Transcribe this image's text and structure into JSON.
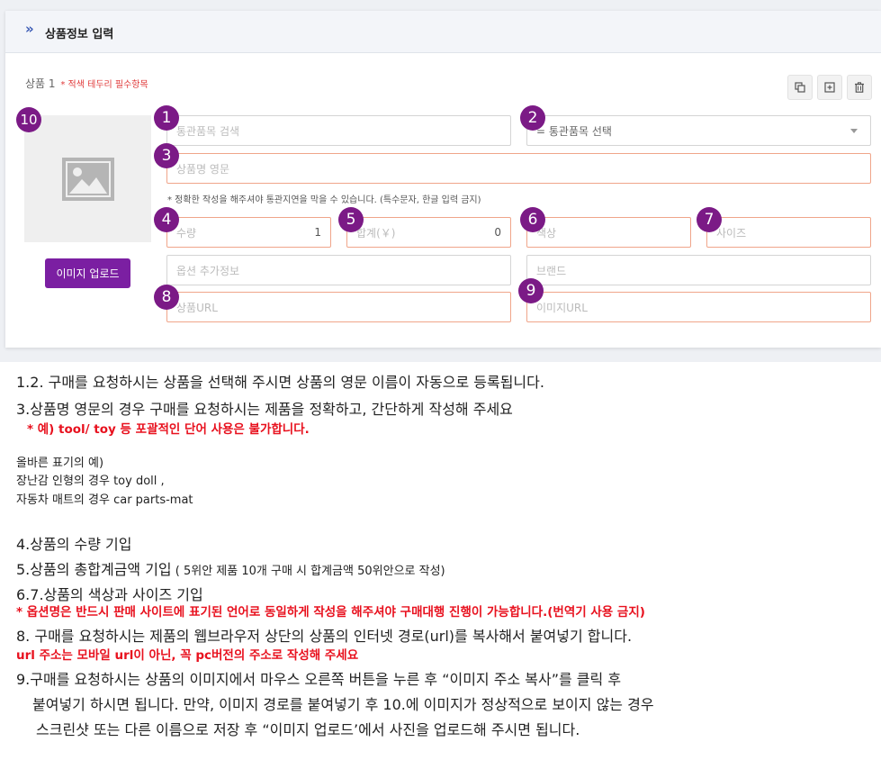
{
  "header": {
    "title": "상품정보 입력"
  },
  "product": {
    "label": "상품 1",
    "required_note": "* 적색 테두리 필수항목"
  },
  "actions": [
    "copy-icon",
    "add-icon",
    "trash-icon"
  ],
  "image": {
    "upload_label": "이미지 업로드"
  },
  "fields": {
    "customs_search": {
      "placeholder": "통관품목 검색"
    },
    "customs_select": {
      "value": "= 통관품목 선택"
    },
    "name_en": {
      "placeholder": "상품명 영문"
    },
    "hint": "* 정확한 작성을 해주셔야 통관지연을 막을 수 있습니다. (특수문자, 한글 입력 금지)",
    "quantity": {
      "placeholder": "수량",
      "value": "1"
    },
    "total": {
      "placeholder": "합계(￥)",
      "value": "0"
    },
    "color": {
      "placeholder": "색상"
    },
    "size": {
      "placeholder": "사이즈"
    },
    "option_info": {
      "placeholder": "옵션 추가정보"
    },
    "brand": {
      "placeholder": "브랜드"
    },
    "product_url": {
      "placeholder": "상품URL"
    },
    "image_url": {
      "placeholder": "이미지URL"
    }
  },
  "badges": [
    "1",
    "2",
    "3",
    "4",
    "5",
    "6",
    "7",
    "8",
    "9",
    "10"
  ],
  "notes": {
    "l1": "1.2. 구매를 요청하시는 상품을 선택해 주시면 상품의 영문 이름이 자동으로 등록됩니다.",
    "l2": "3.상품명 영문의 경우 구매를 요청하시는 제품을 정확하고, 간단하게 작성해 주세요",
    "l3": "* 예) tool/ toy 등 포괄적인 단어 사용은 불가합니다.",
    "l4": "올바른 표기의 예)",
    "l5": "장난감 인형의 경우 toy doll ,",
    "l6": "자동차 매트의 경우 car parts-mat",
    "l7": "4.상품의 수량 기입",
    "l8a": "5.상품의 총합계금액 기입",
    "l8b": " ( 5위안 제품 10개 구매 시 합계금액 50위안으로 작성)",
    "l9": "6.7.상품의 색상과 사이즈 기입",
    "l10": "* 옵션명은 반드시 판매 사이트에 표기된 언어로 동일하게 작성을 해주셔야 구매대행 진행이 가능합니다.(번역기 사용 금지)",
    "l11": "8. 구매를 요청하시는 제품의 웹브라우저 상단의 상품의 인터넷 경로(url)를 복사해서 붙여넣기 합니다.",
    "l12": "url 주소는 모바일 url이 아닌, 꼭 pc버전의 주소로 작성해 주세요",
    "l13": "9.구매를 요청하시는 상품의 이미지에서 마우스 오른쪽 버튼을 누른 후 “이미지 주소 복사”를 클릭 후",
    "l14": "붙여넣기 하시면 됩니다. 만약, 이미지 경로를 붙여넣기 후 10.에 이미지가 정상적으로 보이지 않는 경우",
    "l15": "스크린샷 또는 다른 이름으로 저장 후 “이미지 업로드’에서 사진을 업로드해 주시면 됩니다."
  }
}
